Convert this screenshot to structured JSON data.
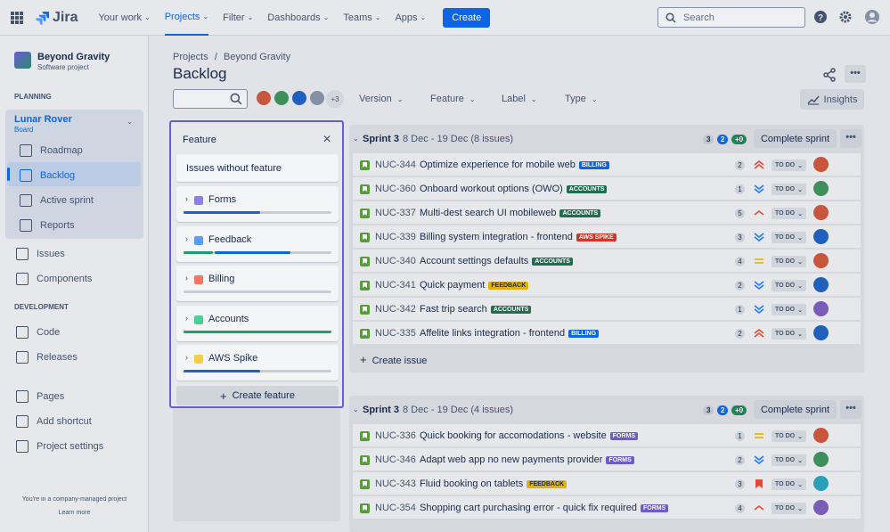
{
  "topnav": {
    "logo_text": "Jira",
    "items": [
      {
        "label": "Your work"
      },
      {
        "label": "Projects"
      },
      {
        "label": "Filter"
      },
      {
        "label": "Dashboards"
      },
      {
        "label": "Teams"
      },
      {
        "label": "Apps"
      }
    ],
    "create_label": "Create",
    "search_placeholder": "Search"
  },
  "sidebar": {
    "project_name": "Beyond Gravity",
    "project_type": "Software project",
    "planning_label": "PLANNING",
    "board_name": "Lunar Rover",
    "board_sub": "Board",
    "planning_items": [
      "Roadmap",
      "Backlog",
      "Active sprint",
      "Reports"
    ],
    "other_items": [
      "Issues",
      "Components"
    ],
    "development_label": "DEVELOPMENT",
    "dev_items": [
      "Code",
      "Releases"
    ],
    "bottom_items": [
      "Pages",
      "Add shortcut",
      "Project settings"
    ],
    "footer_text": "You're in a company-managed project",
    "footer_link": "Learn more"
  },
  "main": {
    "breadcrumb_projects": "Projects",
    "breadcrumb_sep": "/",
    "breadcrumb_project": "Beyond Gravity",
    "title": "Backlog",
    "more_count": "+3",
    "filters": [
      "Version",
      "Feature",
      "Label",
      "Type"
    ],
    "insights_label": "Insights",
    "more_label": "•••"
  },
  "feature_panel": {
    "title": "Feature",
    "close": "✕",
    "without_feature": "Issues without feature",
    "features": [
      {
        "name": "Forms",
        "color": "#8f7ee7",
        "progress_done": 0.52,
        "progress_inprogress": 0
      },
      {
        "name": "Feedback",
        "color": "#579dff",
        "progress_done": 0.2,
        "progress_inprogress": 0.52
      },
      {
        "name": "Billing",
        "color": "#f87462",
        "progress_done": 0,
        "progress_inprogress": 0
      },
      {
        "name": "Accounts",
        "color": "#4bce97",
        "progress_done": 1.0,
        "progress_inprogress": 0
      },
      {
        "name": "AWS Spike",
        "color": "#f5cd47",
        "progress_done": 0.52,
        "progress_inprogress": 0
      }
    ],
    "create_label": "Create feature"
  },
  "sprints": [
    {
      "name": "Sprint 3",
      "dates": "8 Dec - 19 Dec (8 issues)",
      "counts": [
        "3",
        "2",
        "+0"
      ],
      "complete_label": "Complete sprint",
      "issues": [
        {
          "key": "NUC-344",
          "summary": "Optimize experience for mobile web",
          "label": "BILLING",
          "est": "2",
          "priority": "highest",
          "status": "TO DO",
          "avatar": "#c8553d"
        },
        {
          "key": "NUC-360",
          "summary": "Onboard workout options (OWO)",
          "label": "ACCOUNTS",
          "est": "1",
          "priority": "lowest",
          "status": "TO DO",
          "avatar": "#3f8f5a"
        },
        {
          "key": "NUC-337",
          "summary": "Multi-dest search UI mobileweb",
          "label": "ACCOUNTS",
          "est": "5",
          "priority": "high",
          "status": "TO DO",
          "avatar": "#c8553d"
        },
        {
          "key": "NUC-339",
          "summary": "Billing system integration - frontend",
          "label": "AWS SPIKE",
          "est": "3",
          "priority": "lowest",
          "status": "TO DO",
          "avatar": "#1f5fbf"
        },
        {
          "key": "NUC-340",
          "summary": "Account settings defaults",
          "label": "ACCOUNTS",
          "est": "4",
          "priority": "medium",
          "status": "TO DO",
          "avatar": "#c8553d"
        },
        {
          "key": "NUC-341",
          "summary": "Quick payment",
          "label": "FEEDBACK",
          "est": "2",
          "priority": "lowest",
          "status": "TO DO",
          "avatar": "#1f5fbf"
        },
        {
          "key": "NUC-342",
          "summary": "Fast trip search",
          "label": "ACCOUNTS",
          "est": "1",
          "priority": "lowest",
          "status": "TO DO",
          "avatar": "#7a5bb8"
        },
        {
          "key": "NUC-335",
          "summary": "Affelite links integration - frontend",
          "label": "BILLING",
          "est": "2",
          "priority": "highest",
          "status": "TO DO",
          "avatar": "#1f5fbf"
        }
      ],
      "create_issue": "Create issue"
    },
    {
      "name": "Sprint 3",
      "dates": "8 Dec - 19 Dec (4 issues)",
      "counts": [
        "3",
        "2",
        "+0"
      ],
      "complete_label": "Complete sprint",
      "issues": [
        {
          "key": "NUC-336",
          "summary": "Quick booking for accomodations - website",
          "label": "FORMS",
          "est": "1",
          "priority": "medium",
          "status": "TO DO",
          "avatar": "#c8553d"
        },
        {
          "key": "NUC-346",
          "summary": "Adapt web app no new payments provider",
          "label": "FORMS",
          "est": "2",
          "priority": "lowest",
          "status": "TO DO",
          "avatar": "#3f8f5a"
        },
        {
          "key": "NUC-343",
          "summary": "Fluid booking on tablets",
          "label": "FEEDBACK",
          "est": "3",
          "priority": "blocker",
          "status": "TO DO",
          "avatar": "#2aa0b8"
        },
        {
          "key": "NUC-354",
          "summary": "Shopping cart purchasing error - quick fix required",
          "label": "FORMS",
          "est": "4",
          "priority": "high",
          "status": "TO DO",
          "avatar": "#7a5bb8"
        }
      ]
    }
  ],
  "label_colors": {
    "BILLING": {
      "bg": "#0c66e4",
      "fg": "#ffffff"
    },
    "ACCOUNTS": {
      "bg": "#216e4e",
      "fg": "#ffffff"
    },
    "AWS SPIKE": {
      "bg": "#c9372c",
      "fg": "#ffffff"
    },
    "FEEDBACK": {
      "bg": "#e2b203",
      "fg": "#172b4d"
    },
    "FORMS": {
      "bg": "#6e5dc6",
      "fg": "#ffffff"
    }
  }
}
